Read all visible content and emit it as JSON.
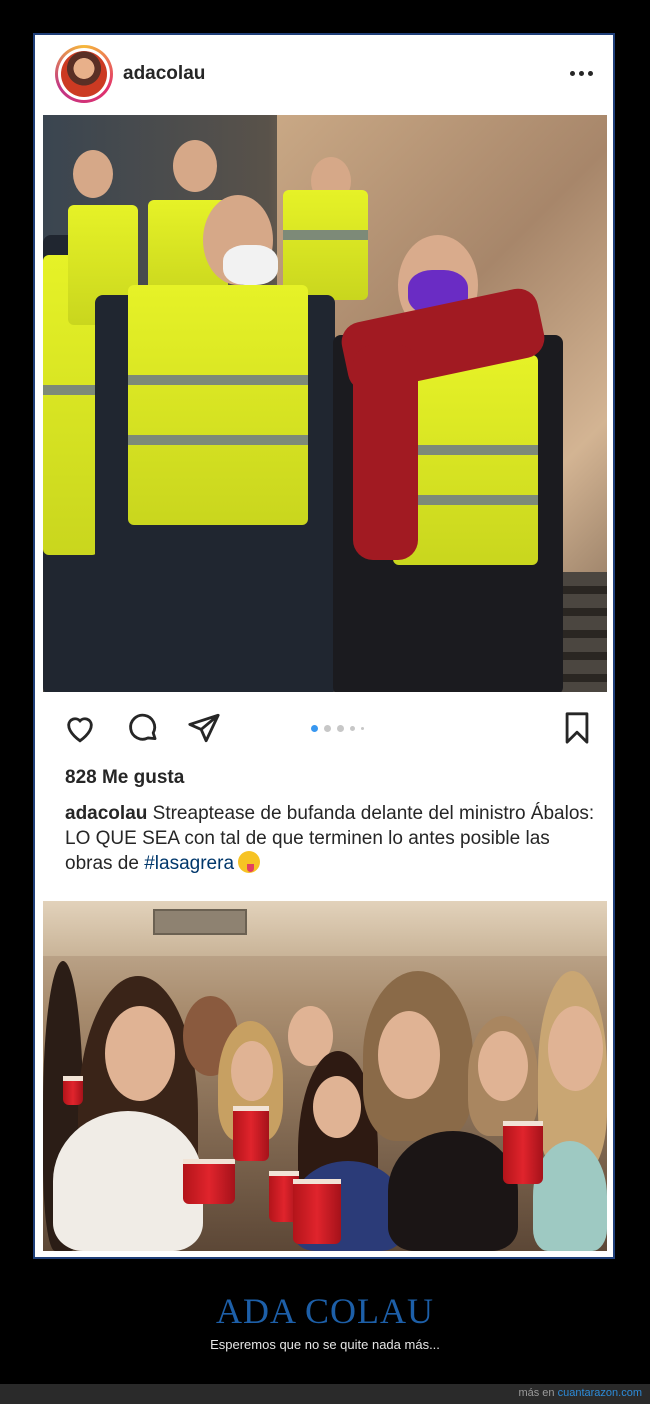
{
  "post": {
    "username": "adacolau",
    "likes": "828 Me gusta",
    "caption_user": "adacolau",
    "caption_text": "Streaptease de bufanda delante del ministro Ábalos: LO QUE SEA con tal de que terminen lo antes posible las obras de ",
    "hashtag": "#lasagrera",
    "carousel": {
      "total": 5,
      "active": 1
    }
  },
  "banner": {
    "title": "ADA COLAU",
    "subtitle": "Esperemos que no se quite nada más..."
  },
  "footer": {
    "prefix": "más en",
    "link": "cuantarazon.com"
  },
  "colors": {
    "frame_border": "#1f3f79",
    "title": "#1d5fa8",
    "hashtag": "#00376b",
    "carousel_active": "#3897f0",
    "link": "#2d8bd8"
  },
  "icons": [
    "more-options-icon",
    "heart-icon",
    "comment-icon",
    "share-icon",
    "bookmark-icon",
    "emoji-wink-tongue-icon"
  ]
}
